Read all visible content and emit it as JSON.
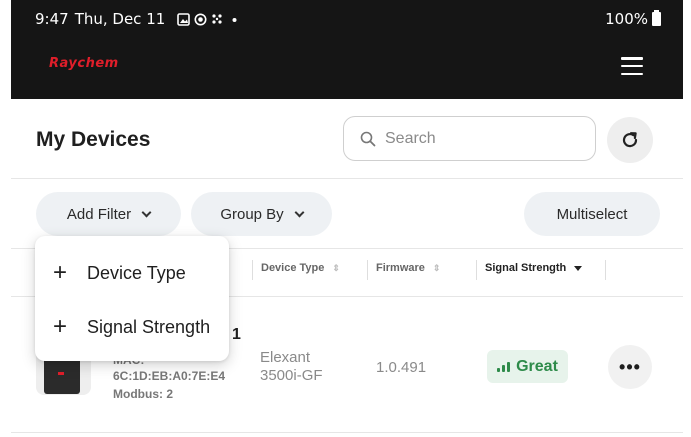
{
  "status_bar": {
    "time": "9:47",
    "date": "Thu, Dec 11",
    "icons": [
      "photo-icon",
      "record-icon",
      "grid-dots-icon",
      "dot-icon"
    ],
    "battery": "100%"
  },
  "app_bar": {
    "brand": "Raychem",
    "brand_color": "#e01e2a",
    "menu_icon": "hamburger-icon"
  },
  "header": {
    "title": "My Devices",
    "search_placeholder": "Search",
    "refresh_icon": "refresh-icon"
  },
  "toolbar": {
    "add_filter": "Add Filter",
    "group_by": "Group By",
    "multiselect": "Multiselect"
  },
  "table": {
    "columns": [
      {
        "label": "Device Type"
      },
      {
        "label": "Firmware"
      },
      {
        "label": "Signal Strength"
      }
    ],
    "rows": [
      {
        "name_visible": "1",
        "mac_label": "MAC:",
        "mac": "6C:1D:EB:A0:7E:E4",
        "modbus": "Modbus: 2",
        "device_type_line1": "Elexant",
        "device_type_line2": "3500i-GF",
        "firmware": "1.0.491",
        "signal": "Great",
        "signal_color": "#2e8b4a",
        "more_icon": "more-horizontal-icon"
      }
    ]
  },
  "filter_menu": {
    "items": [
      {
        "label": "Device Type"
      },
      {
        "label": "Signal Strength"
      }
    ]
  }
}
